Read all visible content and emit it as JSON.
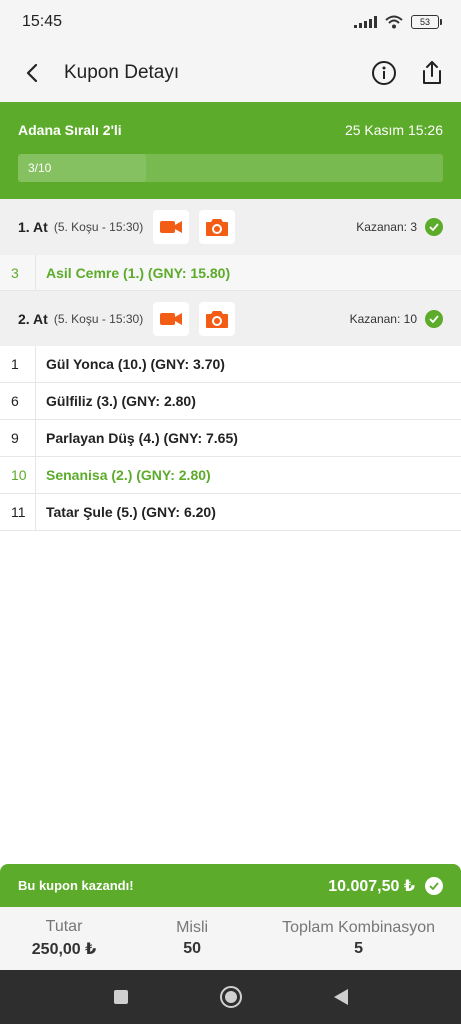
{
  "status": {
    "time": "15:45",
    "battery": "53"
  },
  "header": {
    "title": "Kupon Detayı"
  },
  "coupon": {
    "name": "Adana Sıralı 2'li",
    "date": "25 Kasım 15:26",
    "progress_text": "3/10",
    "progress": 0.3
  },
  "races": [
    {
      "title": "1. At",
      "subtitle": "(5. Koşu - 15:30)",
      "winner_text": "Kazanan: 3",
      "horses": [
        {
          "num": "3",
          "name": "Asil Cemre (1.) (GNY: 15.80)",
          "winner": true
        }
      ]
    },
    {
      "title": "2. At",
      "subtitle": "(5. Koşu - 15:30)",
      "winner_text": "Kazanan: 10",
      "horses": [
        {
          "num": "1",
          "name": "Gül Yonca (10.) (GNY: 3.70)",
          "winner": false
        },
        {
          "num": "6",
          "name": "Gülfiliz (3.) (GNY: 2.80)",
          "winner": false
        },
        {
          "num": "9",
          "name": "Parlayan Düş (4.) (GNY: 7.65)",
          "winner": false
        },
        {
          "num": "10",
          "name": "Senanisa (2.) (GNY: 2.80)",
          "winner": true
        },
        {
          "num": "11",
          "name": "Tatar Şule (5.) (GNY: 6.20)",
          "winner": false
        }
      ]
    }
  ],
  "result": {
    "text": "Bu kupon kazandı!",
    "amount": "10.007,50 ₺"
  },
  "summary": {
    "stake_label": "Tutar",
    "stake_value": "250,00 ₺",
    "multiplier_label": "Misli",
    "multiplier_value": "50",
    "combinations_label": "Toplam Kombinasyon",
    "combinations_value": "5"
  },
  "colors": {
    "accent": "#5cab2a",
    "media": "#f25c14"
  }
}
